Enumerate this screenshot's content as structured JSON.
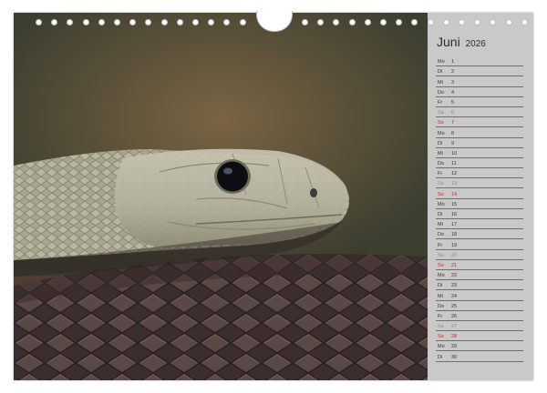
{
  "calendar": {
    "month": "Juni",
    "year": "2026",
    "days": [
      {
        "dow": "Mo",
        "num": "1",
        "type": "weekday"
      },
      {
        "dow": "Di",
        "num": "2",
        "type": "weekday"
      },
      {
        "dow": "Mi",
        "num": "3",
        "type": "weekday"
      },
      {
        "dow": "Do",
        "num": "4",
        "type": "weekday"
      },
      {
        "dow": "Fr",
        "num": "5",
        "type": "weekday"
      },
      {
        "dow": "Sa",
        "num": "6",
        "type": "saturday"
      },
      {
        "dow": "So",
        "num": "7",
        "type": "sunday"
      },
      {
        "dow": "Mo",
        "num": "8",
        "type": "weekday"
      },
      {
        "dow": "Di",
        "num": "9",
        "type": "weekday"
      },
      {
        "dow": "Mi",
        "num": "10",
        "type": "weekday"
      },
      {
        "dow": "Do",
        "num": "11",
        "type": "weekday"
      },
      {
        "dow": "Fr",
        "num": "12",
        "type": "weekday"
      },
      {
        "dow": "Sa",
        "num": "13",
        "type": "saturday"
      },
      {
        "dow": "So",
        "num": "14",
        "type": "sunday"
      },
      {
        "dow": "Mo",
        "num": "15",
        "type": "weekday"
      },
      {
        "dow": "Di",
        "num": "16",
        "type": "weekday"
      },
      {
        "dow": "Mi",
        "num": "17",
        "type": "weekday"
      },
      {
        "dow": "Do",
        "num": "18",
        "type": "weekday"
      },
      {
        "dow": "Fr",
        "num": "19",
        "type": "weekday"
      },
      {
        "dow": "Sa",
        "num": "20",
        "type": "saturday"
      },
      {
        "dow": "So",
        "num": "21",
        "type": "sunday"
      },
      {
        "dow": "Mo",
        "num": "22",
        "type": "weekday"
      },
      {
        "dow": "Di",
        "num": "23",
        "type": "weekday"
      },
      {
        "dow": "Mi",
        "num": "24",
        "type": "weekday"
      },
      {
        "dow": "Do",
        "num": "25",
        "type": "weekday"
      },
      {
        "dow": "Fr",
        "num": "26",
        "type": "weekday"
      },
      {
        "dow": "Sa",
        "num": "27",
        "type": "saturday"
      },
      {
        "dow": "So",
        "num": "28",
        "type": "sunday"
      },
      {
        "dow": "Mo",
        "num": "29",
        "type": "weekday"
      },
      {
        "dow": "Di",
        "num": "30",
        "type": "weekday"
      }
    ]
  },
  "colors": {
    "panel": "#c9c9c9",
    "sunday": "#c0282a",
    "saturday": "#8a8a8a",
    "line": "#6e6e6e"
  }
}
